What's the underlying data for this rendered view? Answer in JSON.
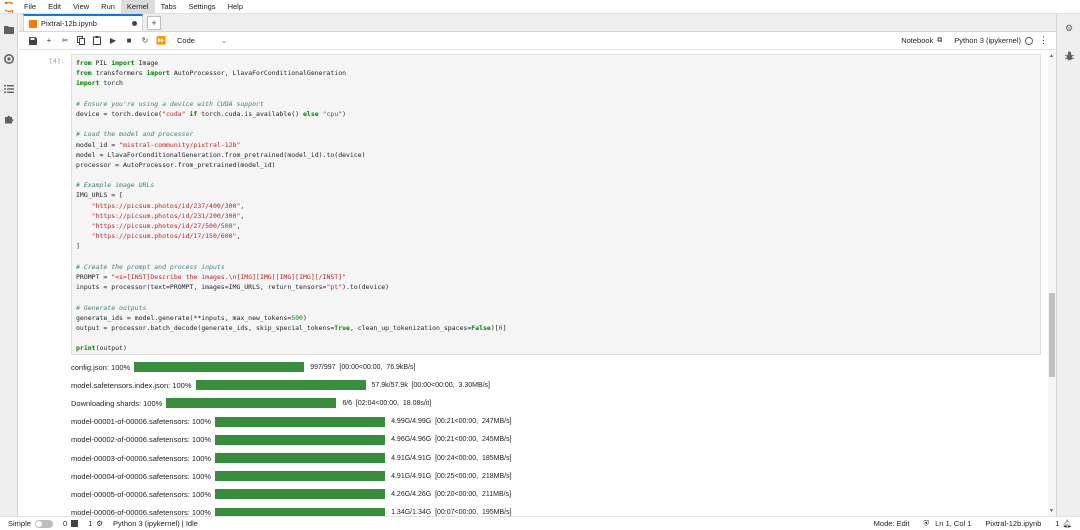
{
  "menubar": {
    "items": [
      "File",
      "Edit",
      "View",
      "Run",
      "Kernel",
      "Tabs",
      "Settings",
      "Help"
    ],
    "active": "Kernel"
  },
  "tab": {
    "title": "Pixtral-12b.ipynb"
  },
  "toolbar": {
    "cell_type": "Code",
    "notebook_label": "Notebook",
    "kernel_label": "Python 3 (ipykernel)"
  },
  "cell": {
    "prompt": "[4]:",
    "lines": [
      "from PIL import Image",
      "from transformers import AutoProcessor, LlavaForConditionalGeneration",
      "import torch",
      "",
      "# Ensure you're using a device with CUDA support",
      "device = torch.device(\"cuda\" if torch.cuda.is_available() else \"cpu\")",
      "",
      "# Load the model and processor",
      "model_id = \"mistral-community/pixtral-12b\"",
      "model = LlavaForConditionalGeneration.from_pretrained(model_id).to(device)",
      "processor = AutoProcessor.from_pretrained(model_id)",
      "",
      "# Example image URLs",
      "IMG_URLS = [",
      "    \"https://picsum.photos/id/237/400/300\",",
      "    \"https://picsum.photos/id/231/200/300\",",
      "    \"https://picsum.photos/id/27/500/500\",",
      "    \"https://picsum.photos/id/17/150/600\",",
      "]",
      "",
      "# Create the prompt and process inputs",
      "PROMPT = \"<s>[INST]Describe the images.\\n[IMG][IMG][IMG][IMG][/INST]\"",
      "inputs = processor(text=PROMPT, images=IMG_URLS, return_tensors=\"pt\").to(device)",
      "",
      "# Generate outputs",
      "generate_ids = model.generate(**inputs, max_new_tokens=500)",
      "output = processor.batch_decode(generate_ids, skip_special_tokens=True, clean_up_tokenization_spaces=False)[0]",
      "",
      "print(output)"
    ]
  },
  "outputs": [
    {
      "label": "config.json:  100%",
      "progress": 1.0,
      "stat": "997/997  [00:00<00:00,  76.9kB/s]"
    },
    {
      "label": "model.safetensors.index.json:  100%",
      "progress": 1.0,
      "stat": "57.9k/57.9k  [00:00<00:00,  3.30MB/s]"
    },
    {
      "label": "Downloading  shards:  100%",
      "progress": 1.0,
      "stat": "6/6  [02:04<00:00,  18.08s/it]"
    },
    {
      "label": "model-00001-of-00006.safetensors:  100%",
      "progress": 1.0,
      "stat": "4.99G/4.99G  [00:21<00:00,  247MB/s]"
    },
    {
      "label": "model-00002-of-00006.safetensors:  100%",
      "progress": 1.0,
      "stat": "4.96G/4.96G  [00:21<00:00,  245MB/s]"
    },
    {
      "label": "model-00003-of-00006.safetensors:  100%",
      "progress": 1.0,
      "stat": "4.91G/4.91G  [00:24<00:00,  185MB/s]"
    },
    {
      "label": "model-00004-of-00006.safetensors:  100%",
      "progress": 1.0,
      "stat": "4.91G/4.91G  [00:25<00:00,  218MB/s]"
    },
    {
      "label": "model-00005-of-00006.safetensors:  100%",
      "progress": 1.0,
      "stat": "4.26G/4.26G  [00:20<00:00,  211MB/s]"
    },
    {
      "label": "model-00006-of-00006.safetensors:  100%",
      "progress": 1.0,
      "stat": "1.34G/1.34G  [00:07<00:00,  195MB/s]"
    }
  ],
  "statusbar": {
    "mode_label": "Simple",
    "count_a": "0",
    "count_b": "1",
    "kernel_status": "Python 3 (ipykernel) | Idle",
    "edit_mode": "Mode: Edit",
    "cursor": "Ln 1, Col 1",
    "filename": "Pixtral-12b.ipynb",
    "notifications": "1"
  },
  "colors": {
    "accent": "#1976d2",
    "progress": "#388e3c",
    "jupyter_orange": "#f57c00"
  }
}
